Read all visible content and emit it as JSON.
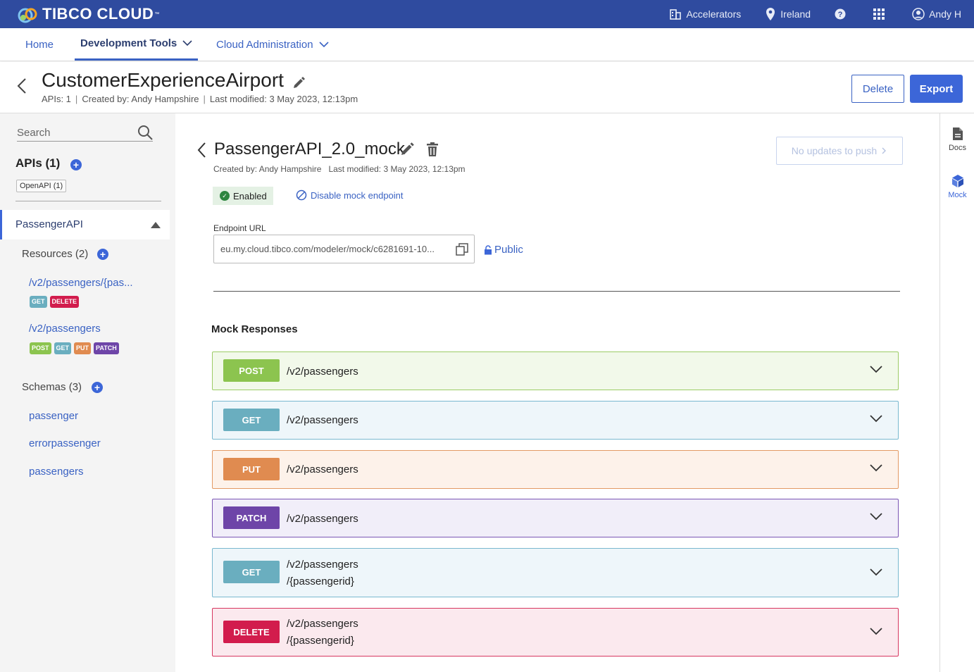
{
  "topbar": {
    "brand": "TIBCO CLOUD",
    "brand_tm": "™",
    "accelerators": "Accelerators",
    "region": "Ireland",
    "user": "Andy H"
  },
  "nav": {
    "home": "Home",
    "dev_tools": "Development Tools",
    "cloud_admin": "Cloud Administration"
  },
  "header": {
    "title": "CustomerExperienceAirport",
    "apis": "APIs: 1",
    "created_by": "Created by: Andy Hampshire",
    "last_modified": "Last modified: 3 May 2023, 12:13pm",
    "delete_label": "Delete",
    "export_label": "Export"
  },
  "sidebar": {
    "search_placeholder": "Search",
    "apis_heading": "APIs (1)",
    "openapi_chip": "OpenAPI (1)",
    "api_name": "PassengerAPI",
    "resources_heading": "Resources (2)",
    "resources": [
      {
        "path": "/v2/passengers/{pas...",
        "methods": [
          "GET",
          "DELETE"
        ]
      },
      {
        "path": "/v2/passengers",
        "methods": [
          "POST",
          "GET",
          "PUT",
          "PATCH"
        ]
      }
    ],
    "schemas_heading": "Schemas (3)",
    "schemas": [
      "passenger",
      "errorpassenger",
      "passengers"
    ]
  },
  "mock": {
    "title": "PassengerAPI_2.0_mock",
    "created_by": "Created by: Andy Hampshire",
    "last_modified": "Last modified: 3 May 2023, 12:13pm",
    "push_label": "No updates to push",
    "status": "Enabled",
    "disable_label": "Disable mock endpoint",
    "endpoint_label": "Endpoint URL",
    "endpoint_url": "eu.my.cloud.tibco.com/modeler/mock/c6281691-10...",
    "visibility": "Public",
    "responses_heading": "Mock Responses",
    "responses": [
      {
        "method": "POST",
        "path_line1": "/v2/passengers",
        "path_line2": ""
      },
      {
        "method": "GET",
        "path_line1": "/v2/passengers",
        "path_line2": ""
      },
      {
        "method": "PUT",
        "path_line1": "/v2/passengers",
        "path_line2": ""
      },
      {
        "method": "PATCH",
        "path_line1": "/v2/passengers",
        "path_line2": ""
      },
      {
        "method": "GET",
        "path_line1": "/v2/passengers",
        "path_line2": "/{passengerid}"
      },
      {
        "method": "DELETE",
        "path_line1": "/v2/passengers",
        "path_line2": "/{passengerid}"
      }
    ]
  },
  "rail": {
    "docs": "Docs",
    "mock": "Mock"
  },
  "colors": {
    "topbar": "#2f4b9f",
    "accent": "#3c66d8",
    "post": "#8cc44f",
    "get": "#6aaebf",
    "put": "#e08b50",
    "patch": "#6e45a8",
    "delete": "#d21c4d"
  }
}
